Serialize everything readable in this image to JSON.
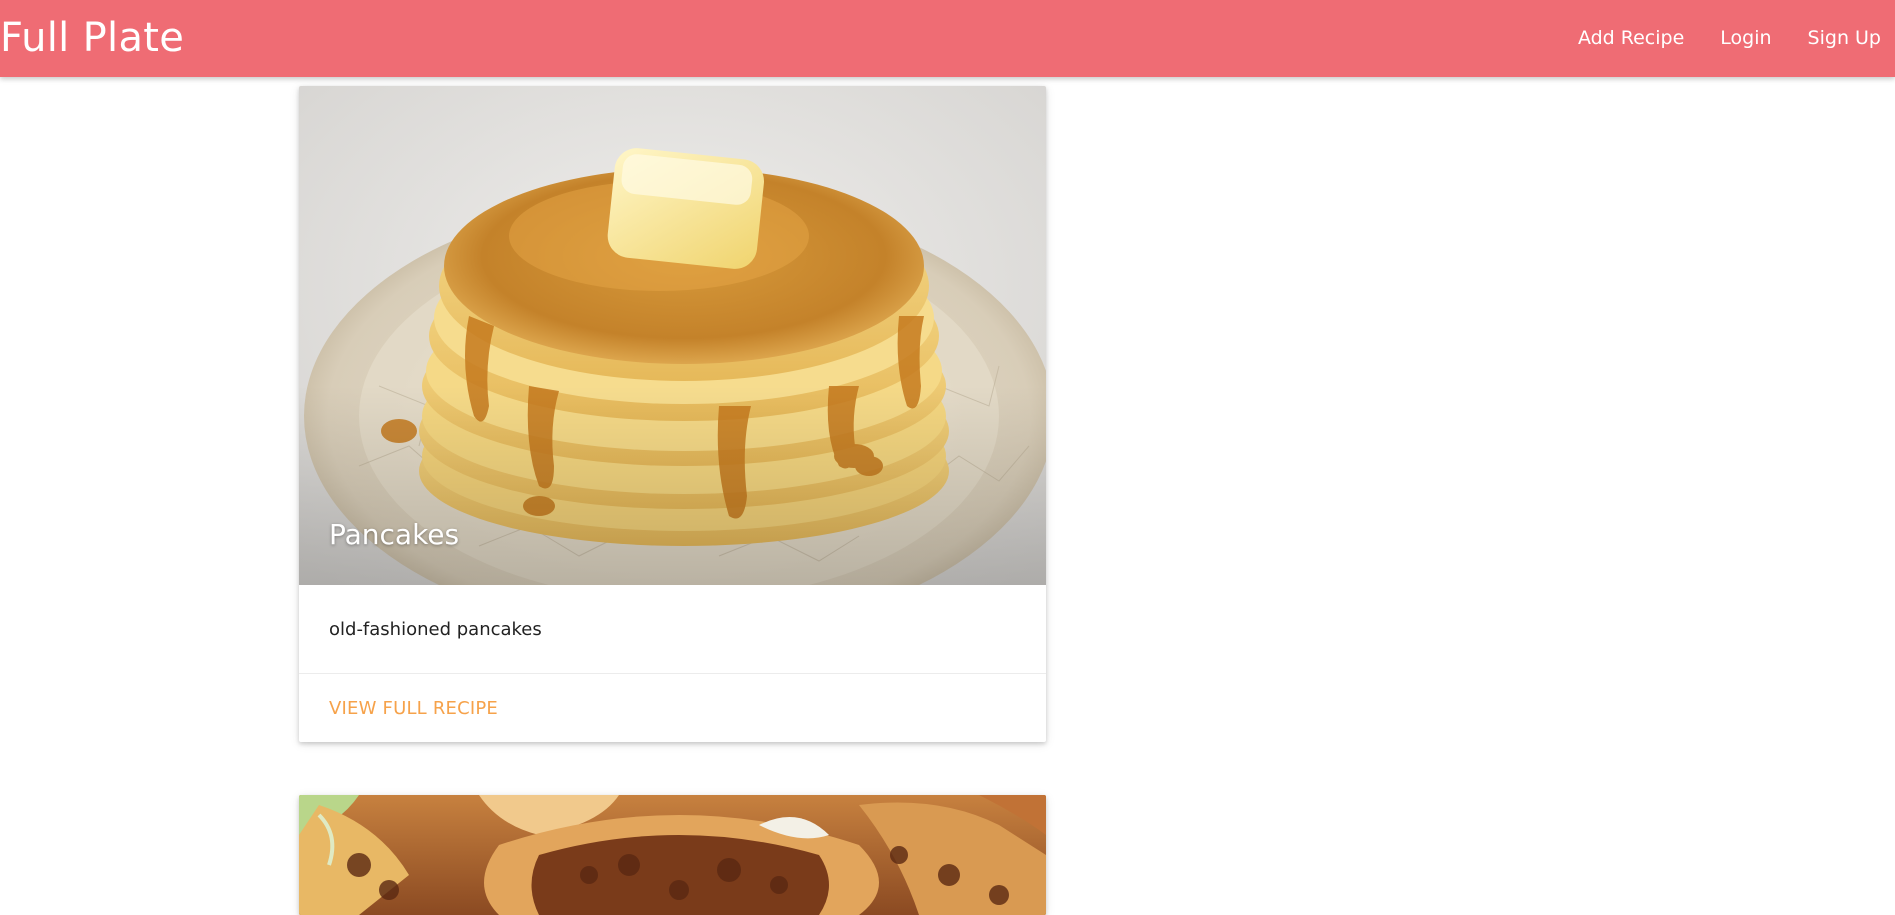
{
  "app": {
    "brand": "Full Plate"
  },
  "nav": {
    "links": [
      {
        "label": "Add Recipe"
      },
      {
        "label": "Login"
      },
      {
        "label": "Sign Up"
      }
    ]
  },
  "recipes": [
    {
      "title": "Pancakes",
      "description": "old-fashioned pancakes",
      "action_label": "VIEW FULL RECIPE",
      "image": "pancakes-photo"
    },
    {
      "image": "tacos-photo"
    }
  ],
  "colors": {
    "navbar": "#ef6c74",
    "accent": "#f6a24a"
  }
}
